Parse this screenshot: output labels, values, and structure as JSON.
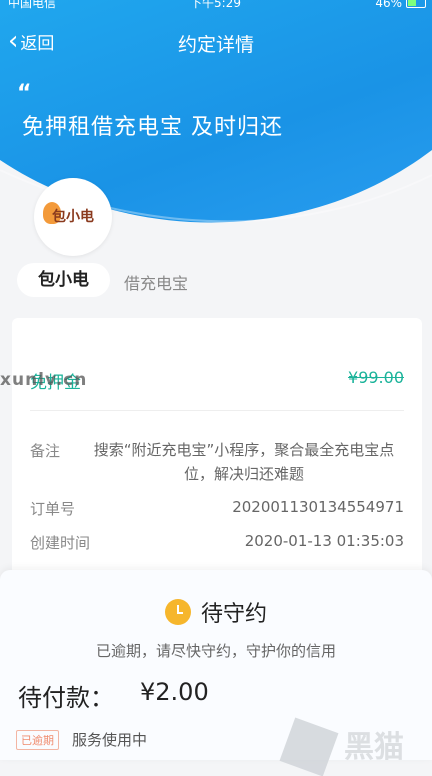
{
  "status_bar": {
    "carrier": "中国电信",
    "time": "下午5:29",
    "battery": "46%"
  },
  "nav": {
    "back_label": "返回",
    "title": "约定详情"
  },
  "hero": {
    "quote": "“",
    "slogan": "免押租借充电宝 及时归还"
  },
  "merchant": {
    "logo_text": "包小电",
    "name": "包小电",
    "category": "借充电宝"
  },
  "order": {
    "deposit_label": "免押金",
    "deposit_price": "¥99.00",
    "note_label": "备注",
    "note_text": "搜索“附近充电宝”小程序，聚合最全充电宝点位，解决归还难题",
    "order_no_label": "订单号",
    "order_no": "202001130134554971",
    "created_label": "创建时间",
    "created_time": "2020-01-13 01:35:03"
  },
  "sheet": {
    "status": "待守约",
    "hint": "已逾期，请尽快守约，守护你的信用",
    "pay_label": "待付款：",
    "pay_amount": "¥2.00",
    "overdue_badge": "已逾期",
    "service_status": "服务使用中"
  },
  "watermark": "xunlv.cn",
  "corner_logo": "黑猫",
  "colors": {
    "primary_blue": "#1a93e6",
    "deposit_green": "#1bb39a",
    "clock_yellow": "#f6b62c",
    "overdue_red": "#f08b6e"
  }
}
